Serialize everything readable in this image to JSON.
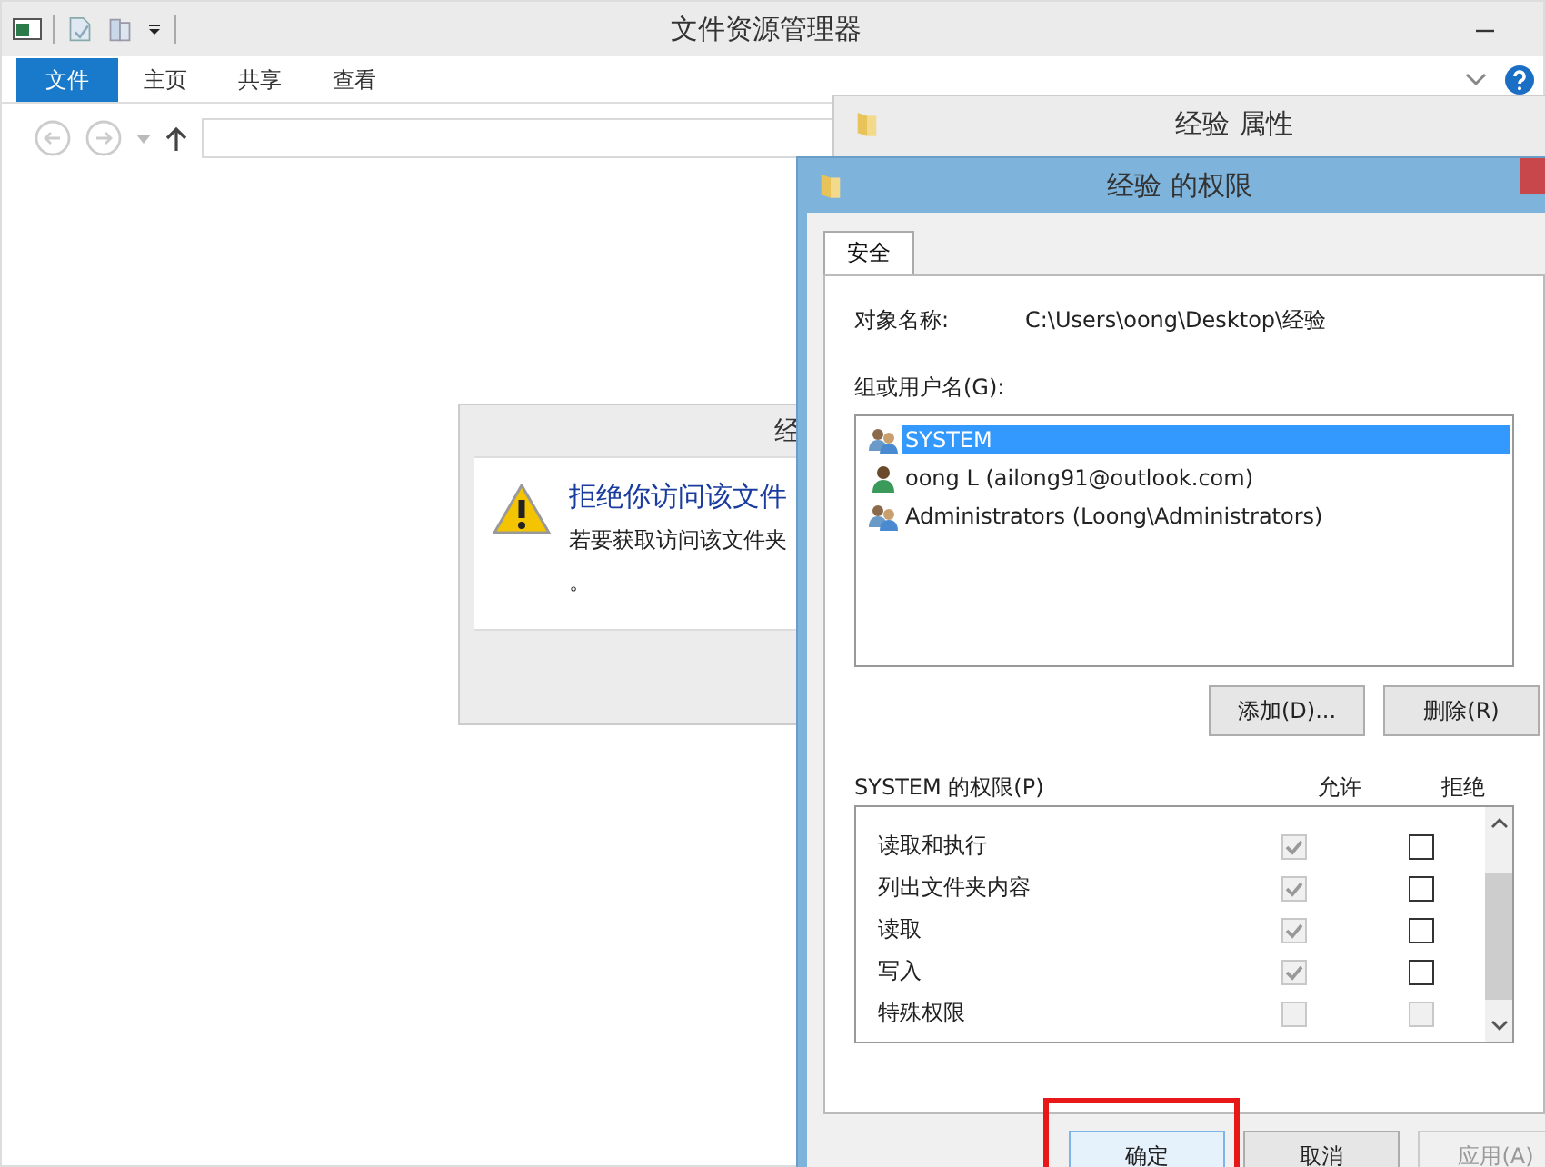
{
  "explorer": {
    "title": "文件资源管理器",
    "ribbon_tabs": [
      {
        "label": "文件",
        "selected": true
      },
      {
        "label": "主页",
        "selected": false
      },
      {
        "label": "共享",
        "selected": false
      },
      {
        "label": "查看",
        "selected": false
      }
    ]
  },
  "error_dialog": {
    "title": "经",
    "heading": "拒绝你访问该文件",
    "message_lines": [
      "若要获取访问该文件夹",
      "。"
    ]
  },
  "properties_dialog": {
    "title": "经验 属性"
  },
  "permissions_dialog": {
    "title": "经验 的权限",
    "tabs": [
      {
        "label": "安全",
        "selected": true
      }
    ],
    "object_label": "对象名称:",
    "object_name": "C:\\Users\\oong\\Desktop\\经验",
    "users_label": "组或用户名(G):",
    "users": [
      {
        "name": "SYSTEM",
        "kind": "group",
        "selected": true
      },
      {
        "name": "oong L (ailong91@outlook.com)",
        "kind": "user",
        "selected": false
      },
      {
        "name": "Administrators (Loong\\Administrators)",
        "kind": "group",
        "selected": false
      }
    ],
    "user_buttons": [
      "添加(D)...",
      "删除(R)"
    ],
    "permissions_label": "SYSTEM 的权限(P)",
    "allow_header": "允许",
    "deny_header": "拒绝",
    "permissions": [
      {
        "name": "读取和执行",
        "allow_checked": true,
        "allow_disabled": true,
        "deny_checked": false,
        "deny_disabled": false
      },
      {
        "name": "列出文件夹内容",
        "allow_checked": true,
        "allow_disabled": true,
        "deny_checked": false,
        "deny_disabled": false
      },
      {
        "name": "读取",
        "allow_checked": true,
        "allow_disabled": true,
        "deny_checked": false,
        "deny_disabled": false
      },
      {
        "name": "写入",
        "allow_checked": true,
        "allow_disabled": true,
        "deny_checked": false,
        "deny_disabled": false
      },
      {
        "name": "特殊权限",
        "allow_checked": false,
        "allow_disabled": true,
        "deny_checked": false,
        "deny_disabled": true
      }
    ],
    "buttons": [
      {
        "label": "确定",
        "disabled": false,
        "highlighted": true
      },
      {
        "label": "取消",
        "disabled": false,
        "highlighted": false
      },
      {
        "label": "应用(A)",
        "disabled": true,
        "highlighted": false
      }
    ]
  }
}
